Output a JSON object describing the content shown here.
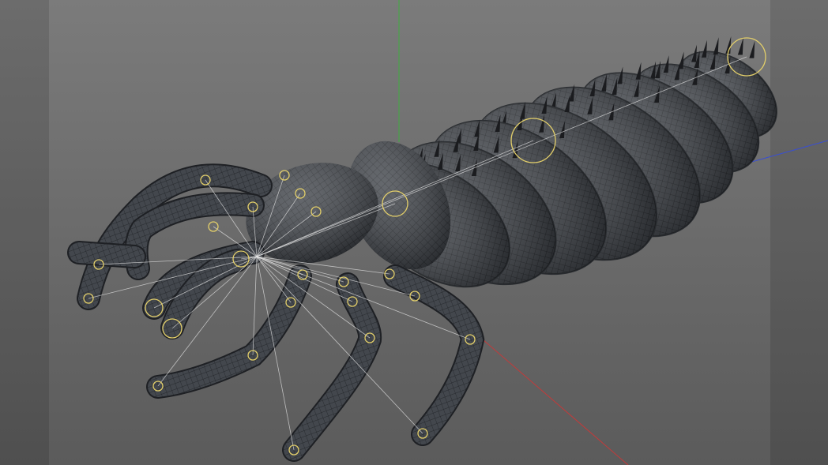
{
  "viewport": {
    "background_top": "#7b7b7b",
    "background_bottom": "#5b5b5b",
    "axis_colors": {
      "x": "#c43a3a",
      "y": "#3fae3f",
      "z": "#3a4fd0"
    },
    "mesh_color": "#3e4247",
    "wire_color": "#1e2024",
    "joint_color": "#e3cf6a",
    "bone_color": "#e8e8e8"
  },
  "icons": [
    "viewport-axis-icon",
    "joint-icon"
  ]
}
